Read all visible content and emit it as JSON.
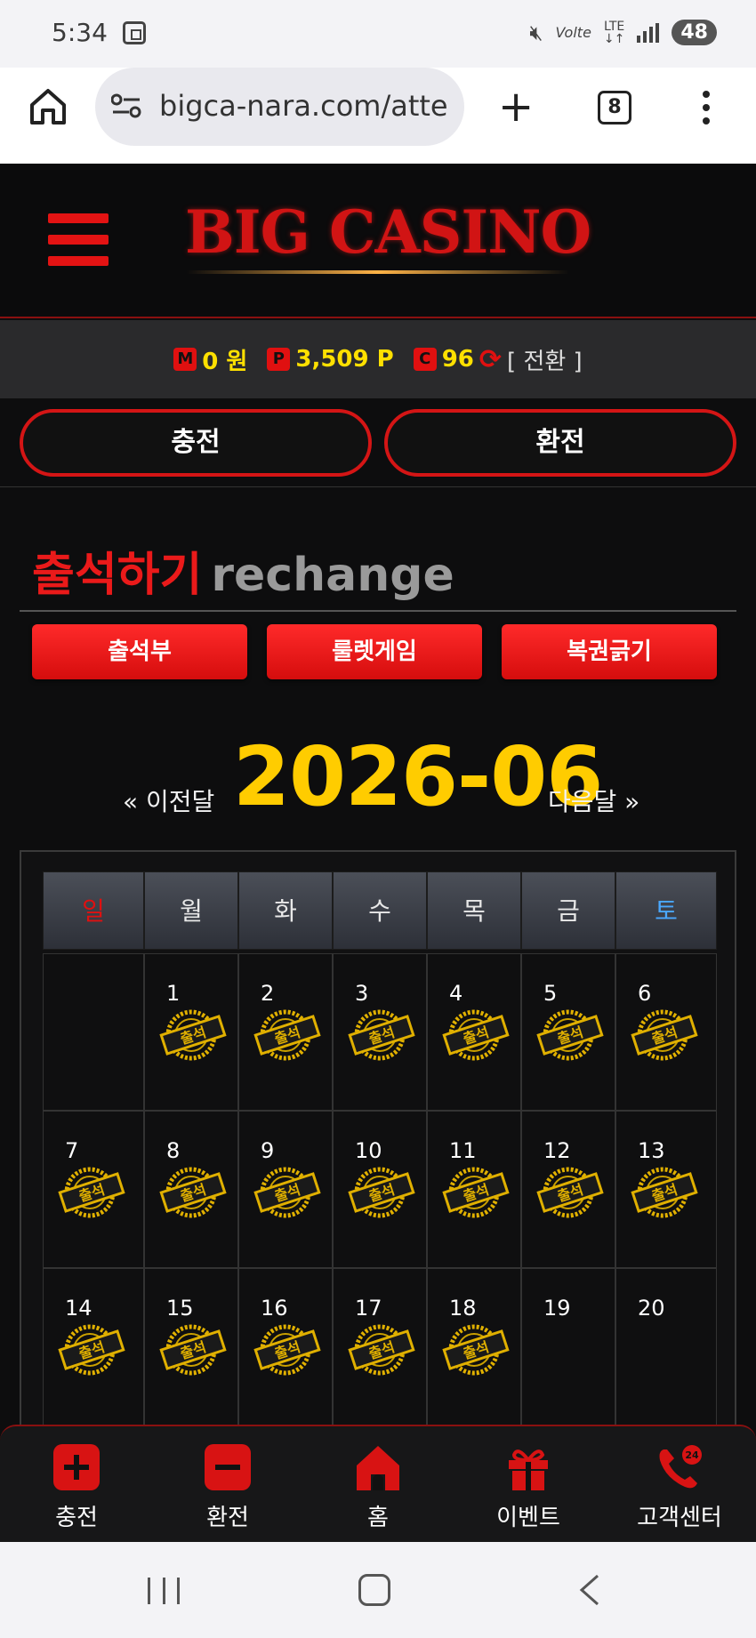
{
  "status_bar": {
    "time": "5:34",
    "network": "LTE",
    "volte": "Volte",
    "battery": "48"
  },
  "browser": {
    "url": "bigca-nara.com/atte",
    "tab_count": "8"
  },
  "header": {
    "logo": "BIG CASINO"
  },
  "points": {
    "money_badge": "M",
    "money": "0 원",
    "point_badge": "P",
    "point": "3,509 P",
    "coin_badge": "C",
    "coin": "96",
    "convert": "[ 전환 ]"
  },
  "actions": {
    "charge": "충전",
    "exchange": "환전"
  },
  "page": {
    "title": "출석하기",
    "subtitle": "rechange"
  },
  "tabs": [
    "출석부",
    "룰렛게임",
    "복권긁기"
  ],
  "calendar": {
    "prev": "« 이전달",
    "month": "2026-06",
    "next": "다음달 »",
    "weekdays": [
      "일",
      "월",
      "화",
      "수",
      "목",
      "금",
      "토"
    ],
    "stamp_text": "출석",
    "weeks": [
      [
        null,
        {
          "d": "1",
          "s": true
        },
        {
          "d": "2",
          "s": true
        },
        {
          "d": "3",
          "s": true
        },
        {
          "d": "4",
          "s": true
        },
        {
          "d": "5",
          "s": true
        },
        {
          "d": "6",
          "s": true
        }
      ],
      [
        {
          "d": "7",
          "s": true
        },
        {
          "d": "8",
          "s": true
        },
        {
          "d": "9",
          "s": true
        },
        {
          "d": "10",
          "s": true
        },
        {
          "d": "11",
          "s": true
        },
        {
          "d": "12",
          "s": true
        },
        {
          "d": "13",
          "s": true
        }
      ],
      [
        {
          "d": "14",
          "s": true
        },
        {
          "d": "15",
          "s": true
        },
        {
          "d": "16",
          "s": true
        },
        {
          "d": "17",
          "s": true
        },
        {
          "d": "18",
          "s": true
        },
        {
          "d": "19",
          "s": false
        },
        {
          "d": "20",
          "s": false
        }
      ]
    ]
  },
  "bottom_nav": [
    {
      "label": "충전",
      "icon": "plus-icon"
    },
    {
      "label": "환전",
      "icon": "minus-icon"
    },
    {
      "label": "홈",
      "icon": "home-icon"
    },
    {
      "label": "이벤트",
      "icon": "gift-icon"
    },
    {
      "label": "고객센터",
      "icon": "phone-24-icon"
    }
  ],
  "colors": {
    "accent_red": "#e01010",
    "gold": "#ffcc00",
    "sunday": "#e01010",
    "saturday": "#4aa8ff"
  }
}
